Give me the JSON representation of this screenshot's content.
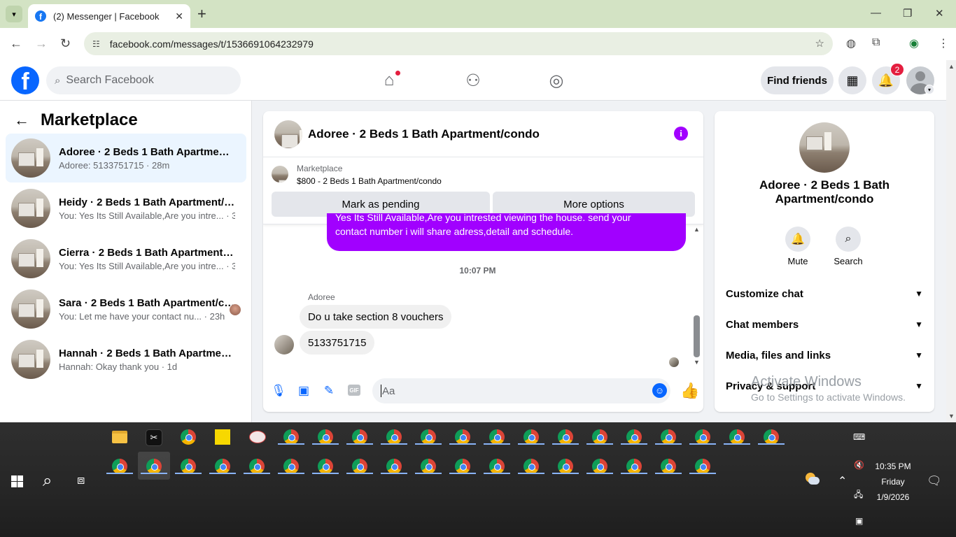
{
  "browser": {
    "tab_title": "(2) Messenger | Facebook",
    "tab_close": "✕",
    "new_tab": "+",
    "url": "facebook.com/messages/t/1536691064232979",
    "window_controls": {
      "minimize": "—",
      "maximize": "❐",
      "close": "✕"
    }
  },
  "fb_header": {
    "logo": "f",
    "search_placeholder": "Search Facebook",
    "find_friends": "Find friends",
    "notification_count": "2"
  },
  "left_panel": {
    "title": "Marketplace",
    "chats": [
      {
        "name": "Adoree · 2 Beds 1 Bath Apartment/condo",
        "preview": "Adoree: 5133751715 · 28m",
        "active": true
      },
      {
        "name": "Heidy · 2 Beds 1 Bath Apartment/condo",
        "preview": "You: Yes Its Still Available,Are you intre... · 3h",
        "active": false
      },
      {
        "name": "Cierra · 2 Beds 1 Bath Apartment/condo",
        "preview": "You: Yes Its Still Available,Are you intre... · 3h",
        "active": false
      },
      {
        "name": "Sara · 2 Beds 1 Bath Apartment/condo",
        "preview": "You: Let me have your contact nu... · 23h",
        "active": false
      },
      {
        "name": "Hannah · 2 Beds 1 Bath Apartment/condo",
        "preview": "Hannah: Okay thank you · 1d",
        "active": false
      }
    ]
  },
  "conversation": {
    "title": "Adoree · 2 Beds 1 Bath Apartment/condo",
    "info_icon": "i",
    "marketplace_label": "Marketplace",
    "listing": "$800 - 2 Beds 1 Bath Apartment/condo",
    "mark_pending": "Mark as pending",
    "more_options": "More options",
    "outgoing_line1": "Yes Its Still Available,Are you intrested viewing the house. send your",
    "outgoing_line2": "contact number i will share adress,detail and schedule.",
    "timestamp": "10:07 PM",
    "sender": "Adoree",
    "incoming": [
      "Do u take section 8 vouchers",
      "5133751715"
    ],
    "composer_placeholder": "Aa"
  },
  "right_panel": {
    "name_line1": "Adoree · 2 Beds 1 Bath",
    "name_line2": "Apartment/condo",
    "mute": "Mute",
    "search": "Search",
    "sections": [
      "Customize chat",
      "Chat members",
      "Media, files and links",
      "Privacy & support"
    ]
  },
  "watermark": {
    "line1": "Activate Windows",
    "line2": "Go to Settings to activate Windows."
  },
  "taskbar": {
    "time": "10:35 PM",
    "day": "Friday",
    "date": "1/9/2026"
  },
  "colors": {
    "messenger_purple": "#a100ff",
    "facebook_blue": "#0866ff",
    "badge_red": "#e41e3f"
  }
}
